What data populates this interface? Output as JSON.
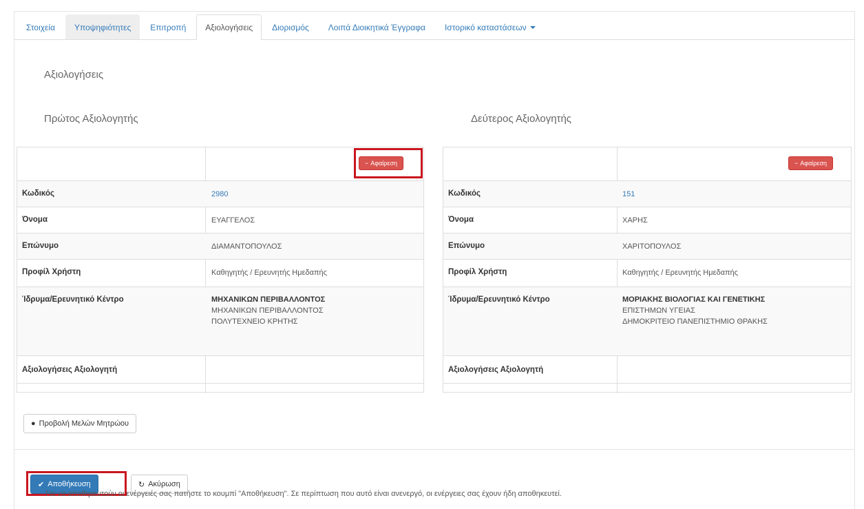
{
  "tabs": [
    {
      "label": "Στοιχεία"
    },
    {
      "label": "Υποψηφιότητες"
    },
    {
      "label": "Επιτροπή"
    },
    {
      "label": "Αξιολογήσεις"
    },
    {
      "label": "Διορισμός"
    },
    {
      "label": "Λοιπά Διοικητικά Έγγραφα"
    },
    {
      "label": "Ιστορικό καταστάσεων"
    }
  ],
  "section_title": "Αξιολογήσεις",
  "evaluator1": {
    "heading": "Πρώτος Αξιολογητής",
    "delete_label": "Αφαίρεση",
    "code_label": "Κωδικός",
    "code": "2980",
    "first_name_label": "Όνομα",
    "first_name": "ΕΥΑΓΓΕΛΟΣ",
    "last_name_label": "Επώνυμο",
    "last_name": "ΔΙΑΜΑΝΤΟΠΟΥΛΟΣ",
    "profile_label": "Προφίλ Χρήστη",
    "profile": "Καθηγητής / Ερευνητής Ημεδαπής",
    "institution_label": "Ίδρυμα/Ερευνητικό Κέντρο",
    "institution_dept": "ΜΗΧΑΝΙΚΩΝ ΠΕΡΙΒΑΛΛΟΝΤΟΣ",
    "institution_school": "ΜΗΧΑΝΙΚΩΝ ΠΕΡΙΒΑΛΛΟΝΤΟΣ",
    "institution_name": "ΠΟΛΥΤΕΧΝΕΙΟ ΚΡΗΤΗΣ",
    "evaluations_label": "Αξιολογήσεις Αξιολογητή"
  },
  "evaluator2": {
    "heading": "Δεύτερος Αξιολογητής",
    "delete_label": "Αφαίρεση",
    "code_label": "Κωδικός",
    "code": "151",
    "first_name_label": "Όνομα",
    "first_name": "ΧΑΡΗΣ",
    "last_name_label": "Επώνυμο",
    "last_name": "ΧΑΡΙΤΟΠΟΥΛΟΣ",
    "profile_label": "Προφίλ Χρήστη",
    "profile": "Καθηγητής / Ερευνητής Ημεδαπής",
    "institution_label": "Ίδρυμα/Ερευνητικό Κέντρο",
    "institution_dept": "ΜΟΡΙΑΚΗΣ ΒΙΟΛΟΓΙΑΣ ΚΑΙ ΓΕΝΕΤΙΚΗΣ",
    "institution_school": "ΕΠΙΣΤΗΜΩΝ ΥΓΕΙΑΣ",
    "institution_name": "ΔΗΜΟΚΡΙΤΕΙΟ ΠΑΝΕΠΙΣΤΗΜΙΟ ΘΡΑΚΗΣ",
    "evaluations_label": "Αξιολογήσεις Αξιολογητή"
  },
  "view_members_label": "Προβολή Μελών Μητρώου",
  "save_label": "Αποθήκευση",
  "cancel_label": "Ακύρωση",
  "help_text": "Για να αποθηκευτούν οι ενέργειές σας πατήστε το κουμπί \"Αποθήκευση\". Σε περίπτωση που αυτό είναι ανενεργό, οι ενέργειες σας έχουν ήδη αποθηκευτεί."
}
